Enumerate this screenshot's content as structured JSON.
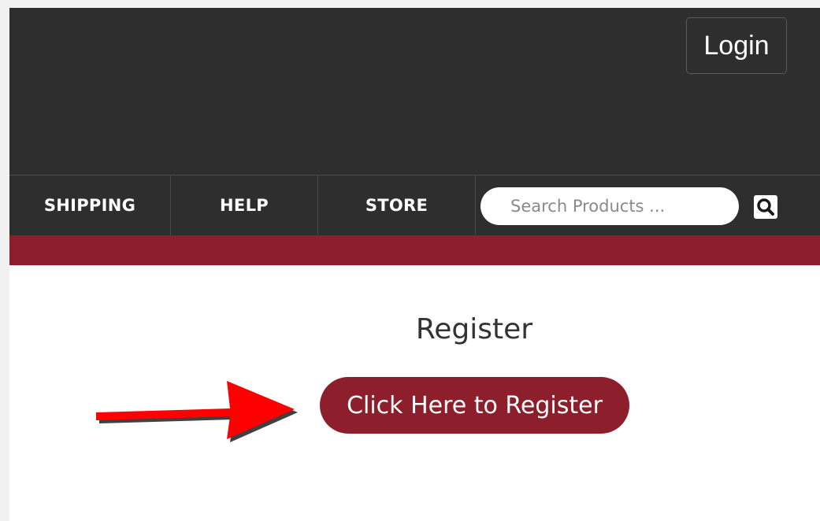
{
  "header": {
    "login_label": "Login"
  },
  "nav": {
    "items": [
      {
        "label": "SHIPPING"
      },
      {
        "label": "HELP"
      },
      {
        "label": "STORE"
      }
    ],
    "search": {
      "placeholder": "Search Products ...",
      "value": ""
    },
    "search_icon": "search-icon"
  },
  "main": {
    "title": "Register",
    "register_button_label": "Click Here to Register"
  },
  "colors": {
    "header_bg": "#2e2e2e",
    "accent": "#8d1e2b",
    "annotation_arrow": "#ff0000"
  },
  "annotation": {
    "icon": "arrow-right-icon"
  }
}
